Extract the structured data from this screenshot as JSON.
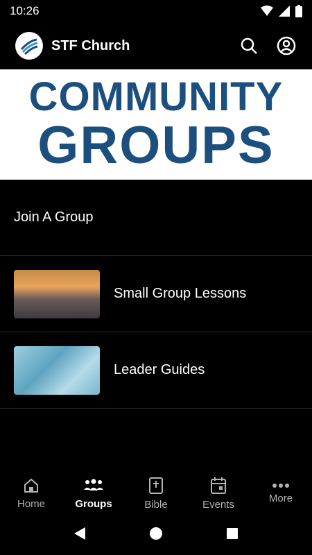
{
  "status": {
    "time": "10:26"
  },
  "app": {
    "title": "STF Church"
  },
  "banner": {
    "line1": "COMMUNITY",
    "line2": "GROUPS"
  },
  "list": [
    {
      "label": "Join A Group"
    },
    {
      "label": "Small Group Lessons"
    },
    {
      "label": "Leader Guides"
    }
  ],
  "nav": [
    {
      "label": "Home",
      "icon": "home-icon"
    },
    {
      "label": "Groups",
      "icon": "groups-icon"
    },
    {
      "label": "Bible",
      "icon": "bible-icon"
    },
    {
      "label": "Events",
      "icon": "calendar-icon"
    },
    {
      "label": "More",
      "icon": "more-icon"
    }
  ],
  "colors": {
    "accent": "#1d4f7e",
    "background": "#000000"
  }
}
